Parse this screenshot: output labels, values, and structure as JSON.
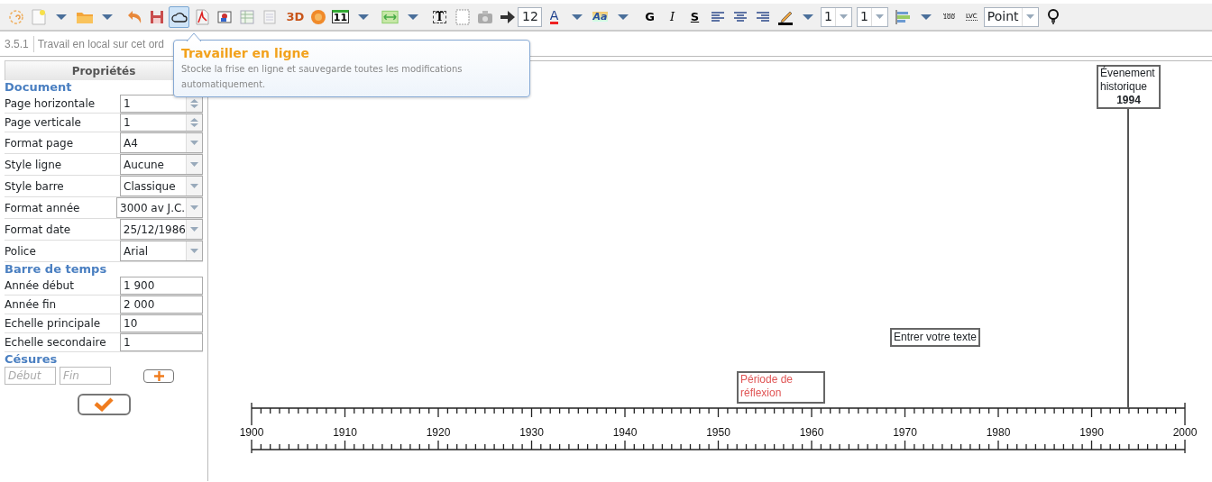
{
  "toolbar": [
    {
      "kind": "button",
      "selected": false
    },
    {
      "kind": "button",
      "selected": false
    },
    {
      "kind": "dropdown"
    },
    {
      "kind": "button",
      "selected": false
    },
    {
      "kind": "dropdown"
    },
    {
      "kind": "button",
      "selected": false
    },
    {
      "kind": "button",
      "selected": false
    },
    {
      "kind": "button",
      "selected": true
    },
    {
      "kind": "button",
      "selected": false
    },
    {
      "kind": "button",
      "selected": false
    },
    {
      "kind": "button",
      "selected": false
    },
    {
      "kind": "button",
      "selected": false
    },
    {
      "kind": "button",
      "label": "3D",
      "selected": false
    },
    {
      "kind": "button",
      "selected": false
    },
    {
      "kind": "button",
      "label": "11",
      "selected": false
    },
    {
      "kind": "dropdown"
    },
    {
      "kind": "button",
      "selected": false
    },
    {
      "kind": "dropdown"
    },
    {
      "kind": "button",
      "label": "T",
      "selected": false
    },
    {
      "kind": "button",
      "selected": false
    },
    {
      "kind": "button",
      "selected": false
    },
    {
      "kind": "button",
      "selected": false
    },
    {
      "kind": "field",
      "value": "12"
    },
    {
      "kind": "button",
      "label": "A",
      "selected": false
    },
    {
      "kind": "dropdown"
    },
    {
      "kind": "button",
      "label": "Aa",
      "selected": false
    },
    {
      "kind": "dropdown"
    },
    {
      "kind": "button",
      "label": "G",
      "selected": false
    },
    {
      "kind": "button",
      "label": "I",
      "selected": false
    },
    {
      "kind": "button",
      "label": "S",
      "selected": false
    },
    {
      "kind": "button",
      "selected": false
    },
    {
      "kind": "button",
      "selected": false
    },
    {
      "kind": "button",
      "selected": false
    },
    {
      "kind": "button",
      "selected": false
    },
    {
      "kind": "dropdown"
    },
    {
      "kind": "combo",
      "value": "1"
    },
    {
      "kind": "combo",
      "value": "1"
    },
    {
      "kind": "button",
      "selected": false
    },
    {
      "kind": "dropdown"
    },
    {
      "kind": "button",
      "label": "100",
      "selected": false
    },
    {
      "kind": "button",
      "label": "LVC",
      "selected": false
    },
    {
      "kind": "combo",
      "value": "Point"
    },
    {
      "kind": "button",
      "selected": false
    }
  ],
  "status_bar": {
    "version": "3.5.1",
    "message": "Travail en local sur cet ord"
  },
  "tooltip": {
    "title": "Travailler en ligne",
    "text": "Stocke la frise en ligne et sauvegarde toutes les modifications automatiquement."
  },
  "properties": {
    "title": "Propriétés",
    "sections": [
      {
        "heading": "Document",
        "rows": [
          {
            "label": "Page horizontale",
            "value": "1",
            "kind": "spin"
          },
          {
            "label": "Page verticale",
            "value": "1",
            "kind": "spin"
          },
          {
            "label": "Format page",
            "value": "A4",
            "kind": "select"
          },
          {
            "label": "Style ligne",
            "value": "Aucune",
            "kind": "select"
          },
          {
            "label": "Style barre",
            "value": "Classique",
            "kind": "select"
          },
          {
            "label": "Format année",
            "value": "3000 av J.C.",
            "kind": "select"
          },
          {
            "label": "Format date",
            "value": "25/12/1986",
            "kind": "select"
          },
          {
            "label": "Police",
            "value": "Arial",
            "kind": "select"
          }
        ]
      },
      {
        "heading": "Barre de temps",
        "rows": [
          {
            "label": "Année début",
            "value": "1 900",
            "kind": "text"
          },
          {
            "label": "Année fin",
            "value": "2 000",
            "kind": "text"
          },
          {
            "label": "Echelle principale",
            "value": "10",
            "kind": "text"
          },
          {
            "label": "Echelle secondaire",
            "value": "1",
            "kind": "text"
          }
        ]
      }
    ],
    "breaks": {
      "heading": "Césures",
      "start_placeholder": "Début",
      "end_placeholder": "Fin"
    }
  },
  "timeline": {
    "year_labels": [
      "1900",
      "1910",
      "1920",
      "1930",
      "1940",
      "1950",
      "1960",
      "1970",
      "1980",
      "1990",
      "2000"
    ],
    "items": [
      {
        "kind": "event",
        "text": "Évenement historique",
        "date": "1994"
      },
      {
        "kind": "note",
        "text": "Entrer votre texte"
      },
      {
        "kind": "period",
        "text": "Période de réflexion"
      }
    ]
  }
}
